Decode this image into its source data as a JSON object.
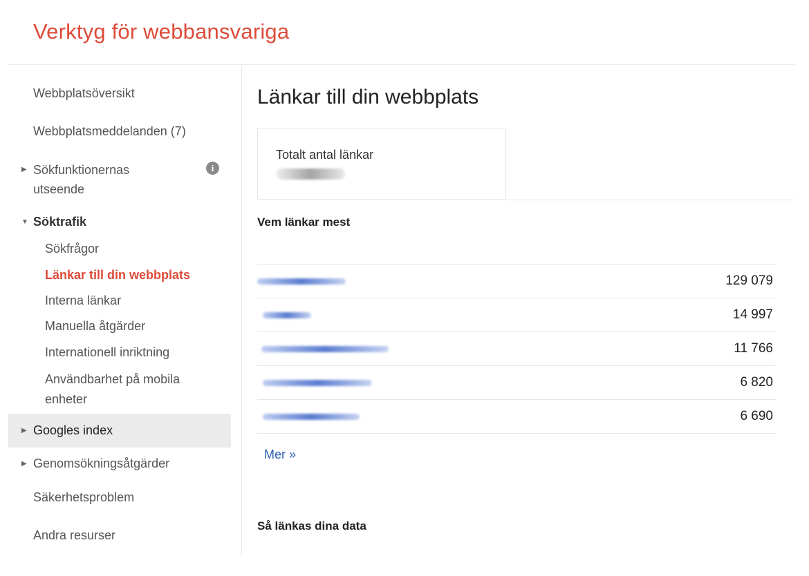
{
  "app": {
    "title": "Verktyg för webbansvariga"
  },
  "sidebar": {
    "items": [
      {
        "label": "Webbplatsöversikt"
      },
      {
        "label": "Webbplatsmeddelanden (7)"
      },
      {
        "label": "Sökfunktionernas",
        "label2": "utseende",
        "icon": "info-icon"
      },
      {
        "label": "Söktrafik",
        "icon": "triangle-down-icon"
      },
      {
        "label": "Sökfrågor"
      },
      {
        "label": "Länkar till din webbplats"
      },
      {
        "label": "Interna länkar"
      },
      {
        "label": "Manuella åtgärder"
      },
      {
        "label": "Internationell inriktning"
      },
      {
        "label": "Användbarhet på mobila",
        "label2": "enheter"
      },
      {
        "label": "Googles index",
        "icon": "triangle-right-icon"
      },
      {
        "label": "Genomsökningsåtgärder",
        "icon": "triangle-right-icon"
      },
      {
        "label": "Säkerhetsproblem"
      },
      {
        "label": "Andra resurser"
      }
    ],
    "active_color": "#dd4b39"
  },
  "main": {
    "title": "Länkar till din webbplats",
    "total": {
      "label": "Totalt antal länkar"
    },
    "top_linkers": {
      "heading": "Vem länkar mest",
      "rows": [
        {
          "count": "129 079"
        },
        {
          "count": "14 997"
        },
        {
          "count": "11 766"
        },
        {
          "count": "6 820"
        },
        {
          "count": "6 690"
        }
      ],
      "more_label": "Mer »"
    },
    "data_heading": "Så länkas dina data"
  }
}
